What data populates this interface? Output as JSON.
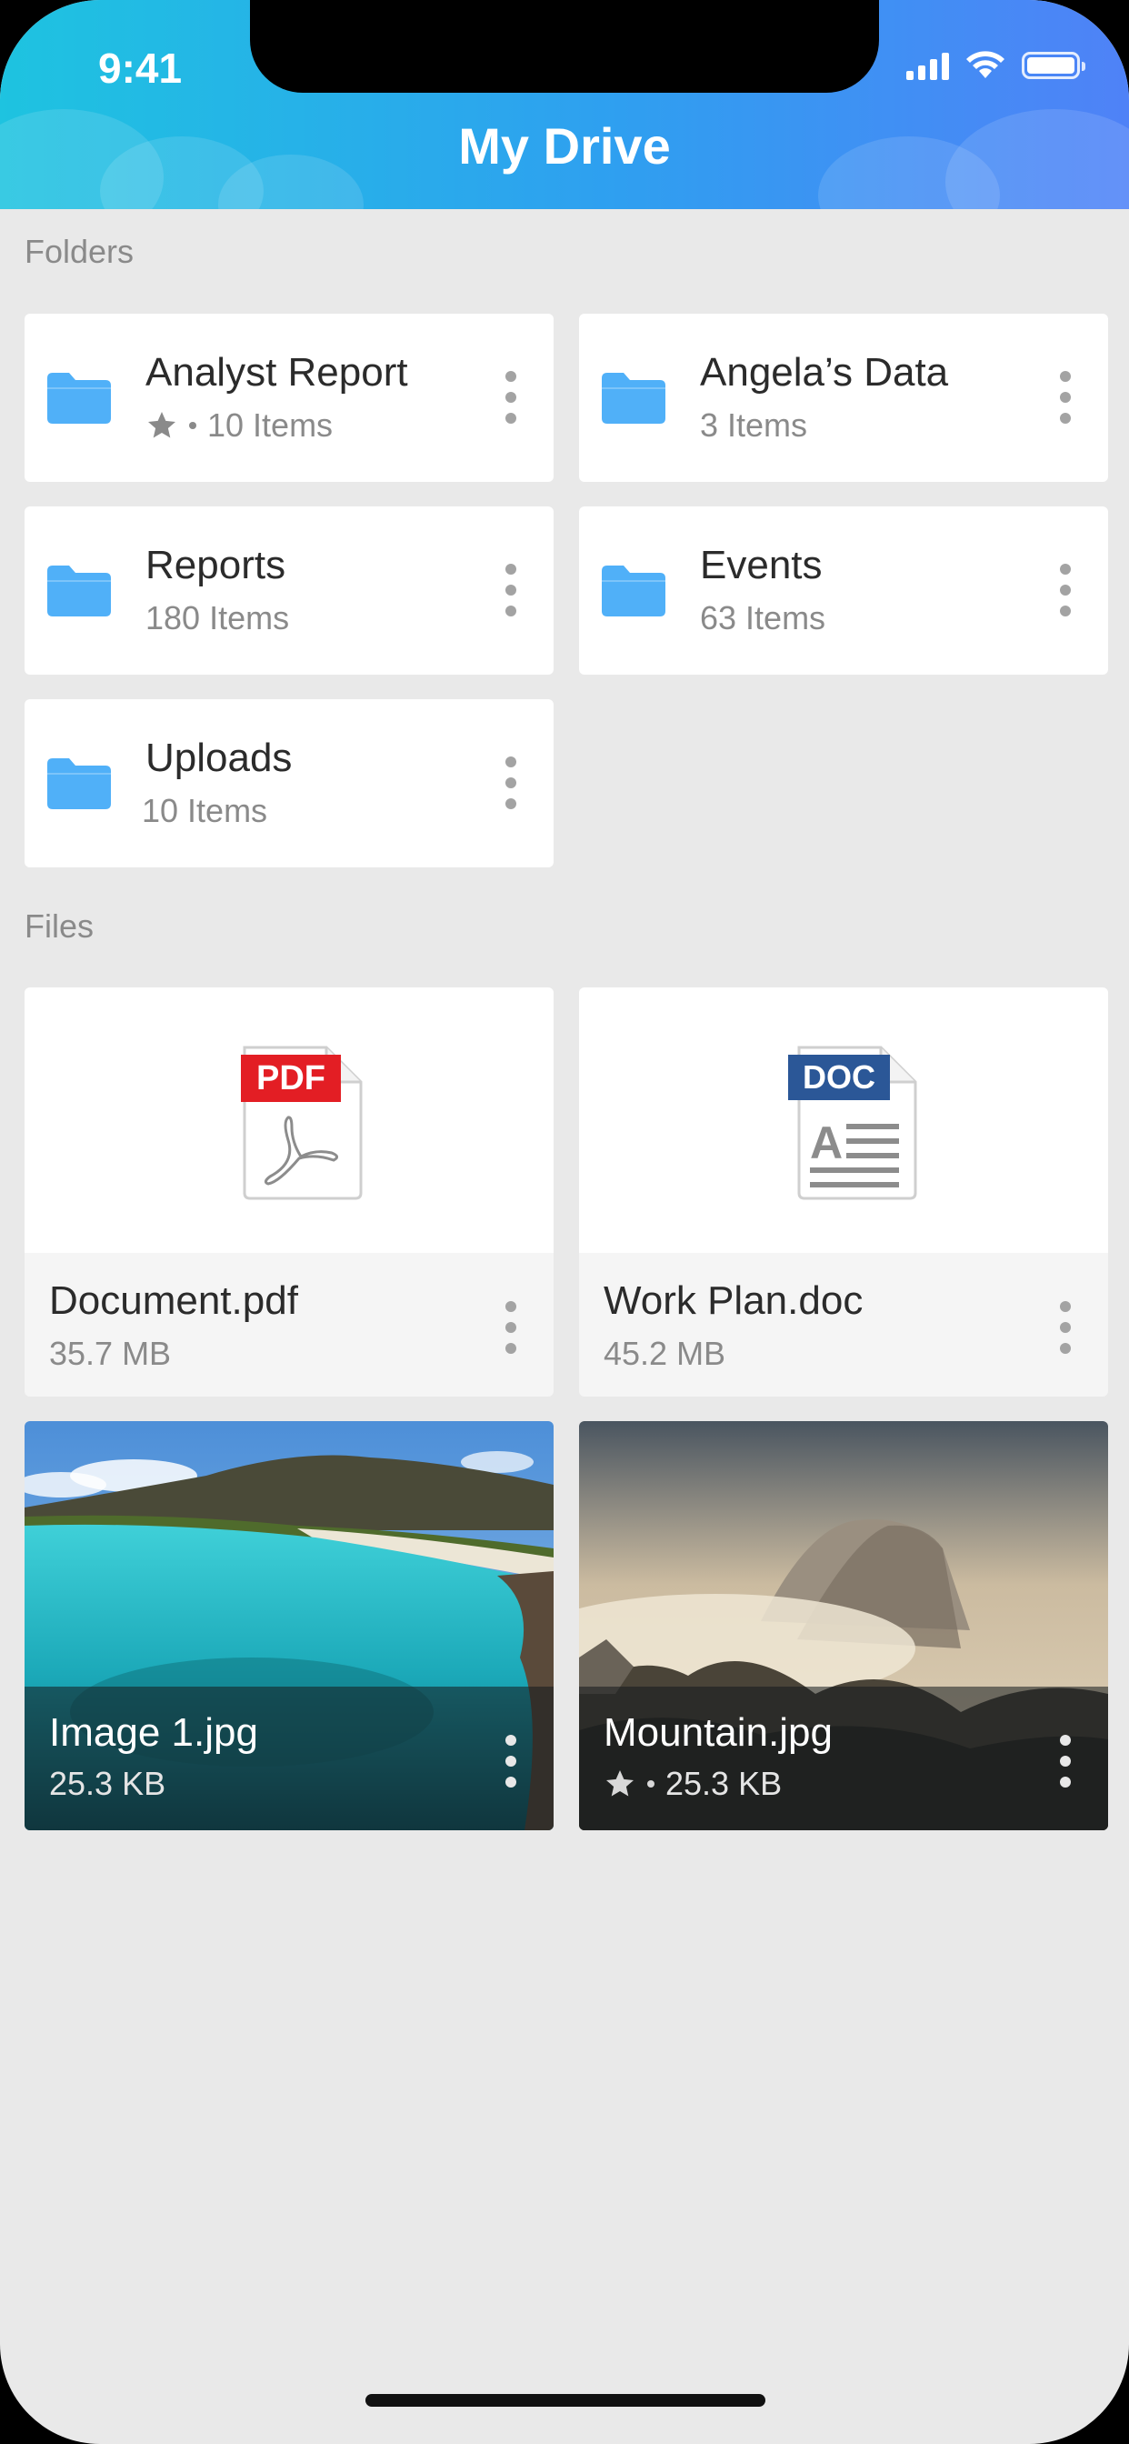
{
  "status_bar": {
    "time": "9:41"
  },
  "header": {
    "title": "My Drive"
  },
  "sections": {
    "folders_label": "Folders",
    "files_label": "Files"
  },
  "folders": [
    {
      "name": "Analyst Report",
      "count": "10 Items",
      "starred": true
    },
    {
      "name": "Angela’s Data",
      "count": "3 Items",
      "starred": false
    },
    {
      "name": "Reports",
      "count": "180 Items",
      "starred": false
    },
    {
      "name": "Events",
      "count": "63 Items",
      "starred": false
    },
    {
      "name": "Uploads",
      "count": "10 Items",
      "starred": false
    }
  ],
  "files": [
    {
      "name": "Document.pdf",
      "size": "35.7 MB",
      "badge": "PDF",
      "badge_color": "#e31e24"
    },
    {
      "name": "Work Plan.doc",
      "size": "45.2 MB",
      "badge": "DOC",
      "badge_color": "#2b5797"
    },
    {
      "name": "Image 1.jpg",
      "size": "25.3 KB",
      "starred": false
    },
    {
      "name": "Mountain.jpg",
      "size": "25.3 KB",
      "starred": true
    }
  ],
  "colors": {
    "folder": "#50b0f8",
    "header_start": "#1ec3e0",
    "header_end": "#4f82f7"
  },
  "icons": [
    "folder-icon",
    "more-vertical-icon",
    "star-icon",
    "pdf-file-icon",
    "doc-file-icon",
    "signal-icon",
    "wifi-icon",
    "battery-icon"
  ]
}
